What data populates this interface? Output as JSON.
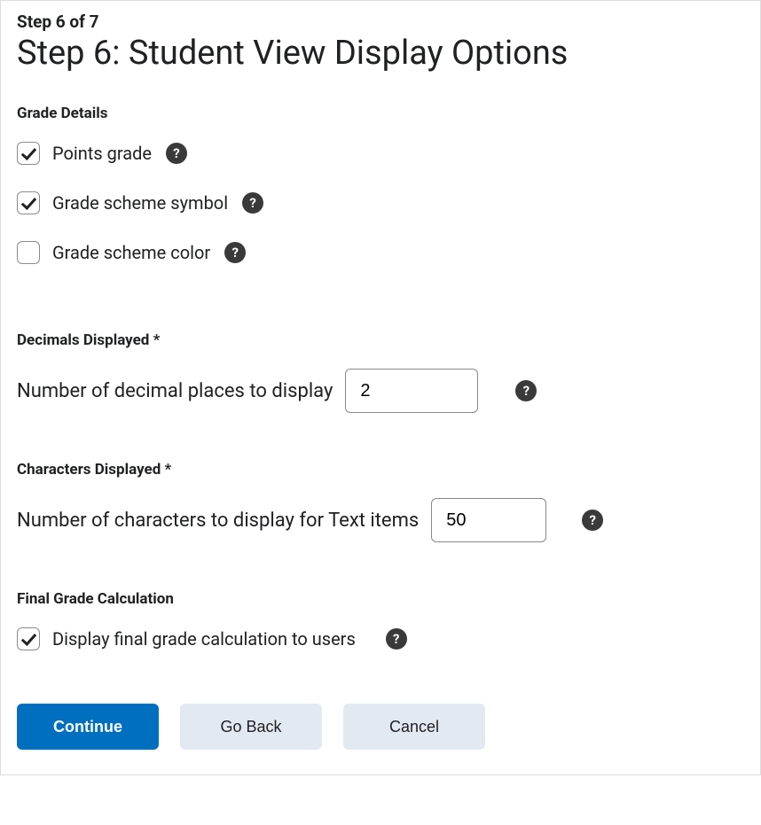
{
  "stepIndicator": "Step 6 of 7",
  "title": "Step 6: Student View Display Options",
  "gradeDetails": {
    "label": "Grade Details",
    "items": [
      {
        "label": "Points grade",
        "checked": true
      },
      {
        "label": "Grade scheme symbol",
        "checked": true
      },
      {
        "label": "Grade scheme color",
        "checked": false
      }
    ]
  },
  "decimals": {
    "sectionLabel": "Decimals Displayed *",
    "fieldLabel": "Number of decimal places to display",
    "value": "2"
  },
  "characters": {
    "sectionLabel": "Characters Displayed *",
    "fieldLabel": "Number of characters to display for Text items",
    "value": "50"
  },
  "finalGrade": {
    "sectionLabel": "Final Grade Calculation",
    "checkboxLabel": "Display final grade calculation to users",
    "checked": true
  },
  "buttons": {
    "continue": "Continue",
    "goBack": "Go Back",
    "cancel": "Cancel"
  },
  "helpGlyph": "?"
}
